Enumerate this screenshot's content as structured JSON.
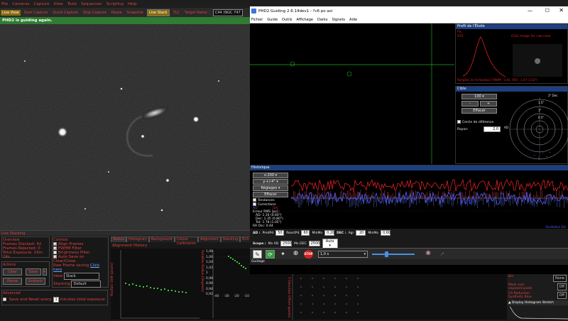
{
  "sharpcap": {
    "menu": [
      "File",
      "Cameras",
      "Capture",
      "View",
      "Tools",
      "Sequencer",
      "Scripting",
      "Help"
    ],
    "toolbar": {
      "live_view": "Live View",
      "start_capture": "Start Capture",
      "quick_capture": "Quick Capture",
      "stop_capture": "Stop Capture",
      "pause": "Pause",
      "snapshot": "Snapshot",
      "live_stack": "Live Stack",
      "tlc": "TLC",
      "target_name_label": "Target Name :",
      "target_name_value": "C44 (NGC 747"
    },
    "status": "PHD2 is guiding again.",
    "live_stacking_title": "Live Stacking",
    "overview": {
      "title": "Overview",
      "frames_stacked_label": "Frames Stacked:",
      "frames_stacked": "42",
      "frames_rejected_label": "Frames Rejected:",
      "frames_rejected": "0",
      "total_exposure_label": "Total Exposure:",
      "total_exposure": "19m 24s"
    },
    "actions": {
      "title": "Actions",
      "clear": "Clear",
      "save": "Save",
      "pause": "Pause",
      "unstack": "Unstack"
    },
    "advanced": {
      "title": "Advanced",
      "save_reset_label": "Save and Reset every",
      "save_reset_value": "1",
      "minutes_label": "minutes total exposure"
    },
    "controls": {
      "title": "Controls",
      "align_frames": "Align Frames",
      "fwhm_filter": "FWHM Filter",
      "brightness_filter": "Brightness Filter",
      "auto_save": "Auto Save on Clear/Close",
      "raw_frame_label": "Raw Frame saving",
      "raw_frame_link": "Click here",
      "view_label": "View",
      "view_value": "Stack",
      "stacking_label": "Stacking",
      "stacking_value": "Default"
    },
    "tabs": [
      "Status",
      "Histogram",
      "Background",
      "Colour Calibration",
      "Alignment",
      "Stacking",
      "Enh"
    ],
    "alignment_history": "Alignment History",
    "chart_ylabel_left": "Position Shift (pixels)",
    "chart_ylabel_mid": "Rotation Radius (Degrees)",
    "chart_ylabel_right": "Y Direction Offset (pixels)",
    "ticks_mid": [
      "1,08",
      "1,06",
      "1,04",
      "1,02",
      "1",
      "0,98",
      "0,96",
      "0,94",
      "0,92"
    ],
    "ticks_mid_x": [
      "-40",
      "-30",
      "-20",
      "-10"
    ]
  },
  "phd2": {
    "title": "PHD2 Guiding 2.6.14dev1 - ?c6 po asi",
    "menu": [
      "Fichier",
      "Guide",
      "Outils",
      "Affichage",
      "Darks",
      "Signets",
      "Aide"
    ],
    "profile_title": "Profil de l'Étoile",
    "profile_text_1": "Pic",
    "profile_text_2": "975",
    "profile_click": "Click image for raw view",
    "profile_footer": "Rangées (à mi-hauteur) FWHM : 3.44, HFD : 3.47 (3.02\")",
    "target_title": "Cible",
    "target_zoom": "100",
    "target_minus": "-",
    "target_plus": "+",
    "target_clear": "Effacer",
    "target_ref_circle": "Cercle de référence",
    "target_radius_label": "Rayon:",
    "target_radius_value": "2,0",
    "target_scale": [
      "2\" Dec",
      "1.5\"",
      "1\"",
      "0.5\""
    ],
    "target_ad": "AD",
    "history_title": "Historique",
    "history_x": "x:200",
    "history_y": "y:+/-4\"",
    "history_settings": "Réglages",
    "history_clear": "Effacer",
    "history_trends": "Tendances",
    "history_corrections": "Corrections",
    "history_ad": "AD",
    "history_dec": "Dec",
    "rms_title": "Erreur RMS [px] :",
    "rms_ad": "AD: 1.16 (0.60\")",
    "rms_dec": "Dec: 1.35 (0.80\")",
    "rms_tot": "Tot: 1.78 (1.05\")",
    "ra_osc": "RA Osc: 0.44",
    "oscillation_label": "Oscillation Est.",
    "ad_row": {
      "label": "AD :",
      "predpd_label": "PredPd",
      "predpd": "50",
      "reactpd_label": "ReactPd",
      "reactpd": "60",
      "minmo_label": "MinMo",
      "minmo": "0,20",
      "dec_label": "DEC :",
      "agr_label": "Agr",
      "agr": "20",
      "minmo2_label": "MinMo",
      "minmo2": "0,60"
    },
    "scope_row": {
      "label": "Scope :",
      "mxad_label": "Mx AD",
      "mxad": "2500",
      "mxdec_label": "Mx DEC",
      "mxdec": "2500",
      "mode": "Auto"
    },
    "exposure": "1,0 s",
    "stop_label": "STOP",
    "guidage": "Guidage",
    "status_frame": "1/3",
    "status_rsb_label": "RSB",
    "status_rsb": "75,7",
    "status_pulse": "20 ms, 0,5 px",
    "status_pulse2": "16 ms, 2,7 px",
    "status_dark": "Dark",
    "status_cal": "Cal"
  },
  "sharpcap_right": {
    "labels": [
      "Bin",
      "Mask over exposed pixels",
      "CA Reduction Synthetic Blue"
    ],
    "values": [
      "None",
      "Off",
      "Off"
    ],
    "histogram_title": "Display Histogram Stretch"
  },
  "colors": {
    "accent_red": "#e04040",
    "guiding_green": "#2e7d32",
    "phd_blue_header": "#1e3f7f",
    "ra_line": "#5060ff",
    "dec_line": "#e02020"
  }
}
